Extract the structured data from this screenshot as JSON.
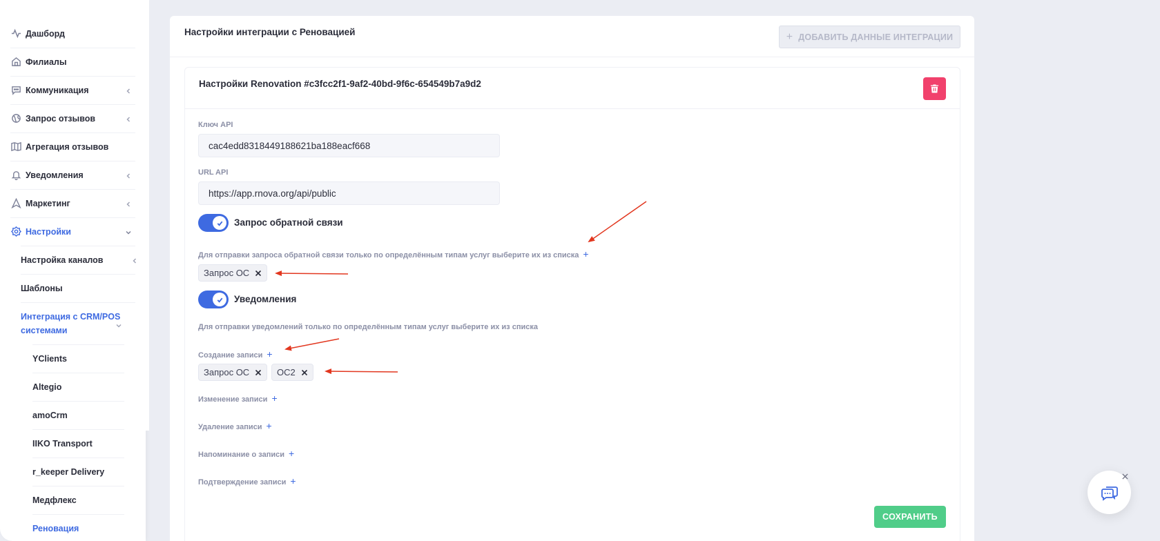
{
  "sidebar": {
    "items": [
      {
        "label": "Дашборд",
        "icon": "activity-icon"
      },
      {
        "label": "Филиалы",
        "icon": "home-icon"
      },
      {
        "label": "Коммуникация",
        "icon": "message-icon"
      },
      {
        "label": "Запрос отзывов",
        "icon": "globe-icon"
      },
      {
        "label": "Агрегация отзывов",
        "icon": "map-icon"
      },
      {
        "label": "Уведомления",
        "icon": "bell-icon"
      },
      {
        "label": "Маркетинг",
        "icon": "navigation-icon"
      },
      {
        "label": "Настройки",
        "icon": "settings-icon"
      }
    ],
    "sub_items": [
      {
        "label": "Настройка каналов"
      },
      {
        "label": "Шаблоны"
      },
      {
        "label": "Интеграция с CRM/POS системами"
      }
    ],
    "crm_items": [
      {
        "label": "YClients"
      },
      {
        "label": "Altegio"
      },
      {
        "label": "amoCrm"
      },
      {
        "label": "IIKO Transport"
      },
      {
        "label": "r_keeper Delivery"
      },
      {
        "label": "Медфлекс"
      },
      {
        "label": "Реновация"
      }
    ]
  },
  "card": {
    "title": "Настройки интеграции с Реновацией",
    "add_button": "ДОБАВИТЬ ДАННЫЕ ИНТЕГРАЦИИ"
  },
  "integration": {
    "title": "Настройки Renovation #c3fcc2f1-9af2-40bd-9f6c-654549b7a9d2",
    "api_key_label": "Ключ API",
    "api_key_value": "cac4edd8318449188621ba188eacf668",
    "api_url_label": "URL API",
    "api_url_value": "https://app.rnova.org/api/public",
    "feedback_toggle_label": "Запрос обратной связи",
    "feedback_toggle_on": true,
    "feedback_hint": "Для отправки запроса обратной связи только по определённым типам услуг выберите их из списка",
    "feedback_chips": [
      "Запрос ОС"
    ],
    "notifications_toggle_label": "Уведомления",
    "notifications_toggle_on": true,
    "notifications_hint": "Для отправки уведомлений только по определённым типам услуг выберите их из списка",
    "record_create_label": "Создание записи",
    "record_create_chips": [
      "Запрос ОС",
      "ОС2"
    ],
    "record_change_label": "Изменение записи",
    "record_delete_label": "Удаление записи",
    "record_reminder_label": "Напоминание о записи",
    "record_confirm_label": "Подтверждение записи",
    "plus_symbol": "+",
    "save_button": "СОХРАНИТЬ"
  },
  "colors": {
    "accent": "#3e6ae1",
    "danger": "#f1416c",
    "success": "#50cd89",
    "annotation_arrow": "#e2371f"
  }
}
